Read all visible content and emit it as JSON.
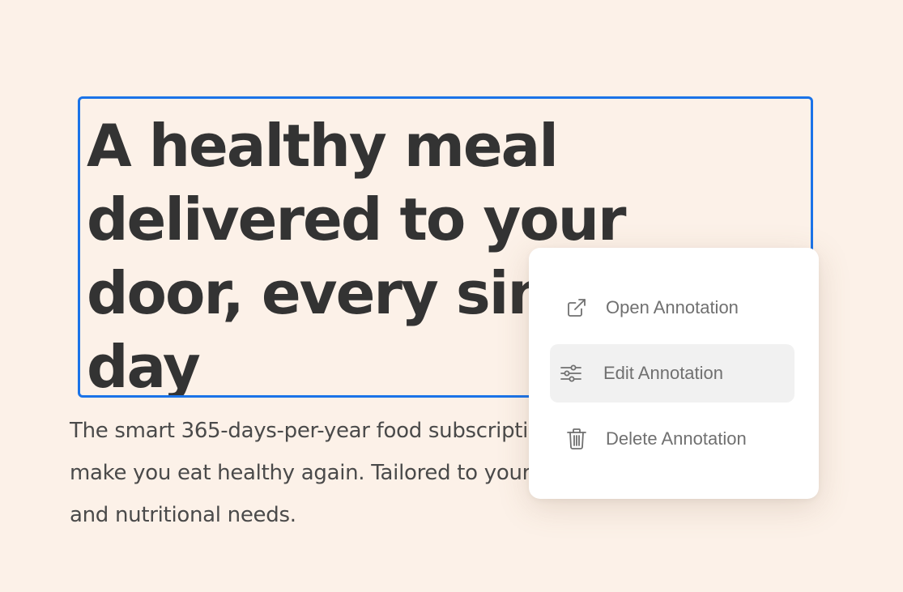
{
  "hero": {
    "headline_lines": [
      "A healthy meal",
      "delivered to your",
      "door, every single",
      "day"
    ],
    "subtext_lines": [
      "The smart 365-days-per-year food subscription that will",
      "make you eat healthy again. Tailored to your personal tastes",
      "and nutritional needs."
    ]
  },
  "context_menu": {
    "items": [
      {
        "label": "Open Annotation",
        "icon": "external-link-icon",
        "active": false
      },
      {
        "label": "Edit Annotation",
        "icon": "sliders-icon",
        "active": true
      },
      {
        "label": "Delete Annotation",
        "icon": "trash-icon",
        "active": false
      }
    ]
  },
  "colors": {
    "page_background": "#fcf1e8",
    "selection_border": "#1a73e8",
    "headline_text": "#333333",
    "body_text": "#4a4a4a",
    "menu_background": "#ffffff",
    "menu_hover": "#f1f1f1",
    "menu_text": "#707070"
  }
}
